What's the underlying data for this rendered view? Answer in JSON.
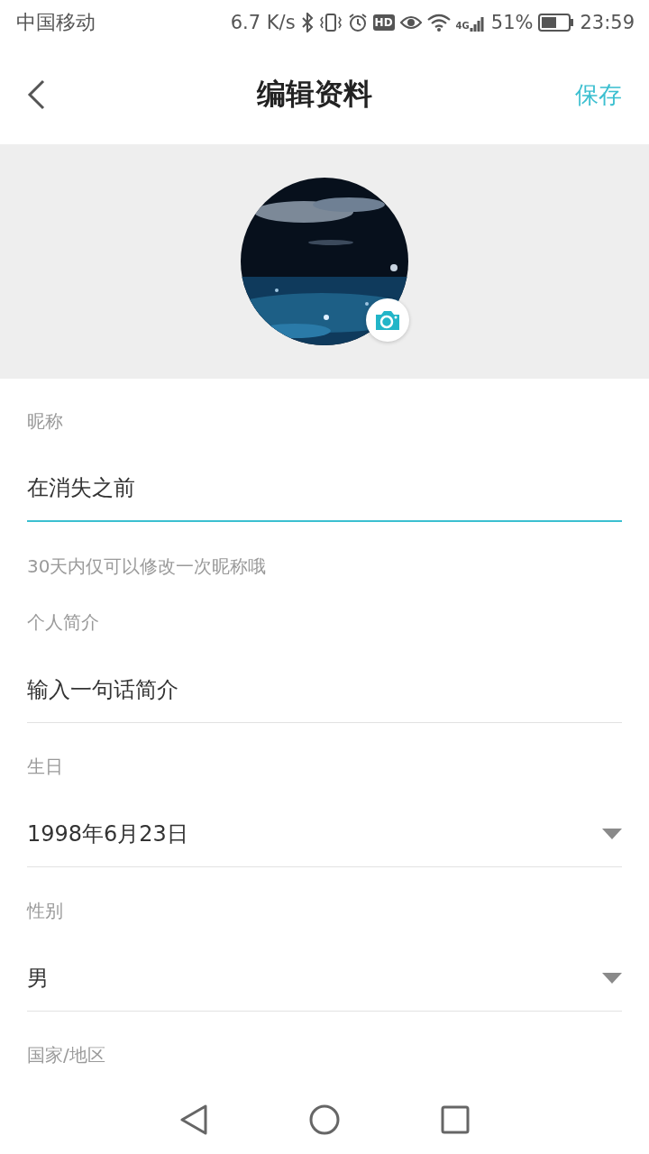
{
  "status_bar": {
    "carrier": "中国移动",
    "speed": "6.7 K/s",
    "hd": "HD",
    "network": "4G",
    "battery": "51%",
    "time": "23:59"
  },
  "header": {
    "title": "编辑资料",
    "action": "保存"
  },
  "fields": [
    {
      "kind": "input",
      "label": "昵称",
      "value": "在消失之前",
      "focused": true,
      "helper": "30天内仅可以修改一次昵称哦"
    },
    {
      "kind": "input",
      "label": "个人简介",
      "placeholder": "输入一句话简介",
      "focused": false
    },
    {
      "kind": "select",
      "label": "生日",
      "value": "1998年6月23日"
    },
    {
      "kind": "select",
      "label": "性别",
      "value": "男"
    },
    {
      "kind": "label",
      "label": "国家/地区"
    }
  ]
}
